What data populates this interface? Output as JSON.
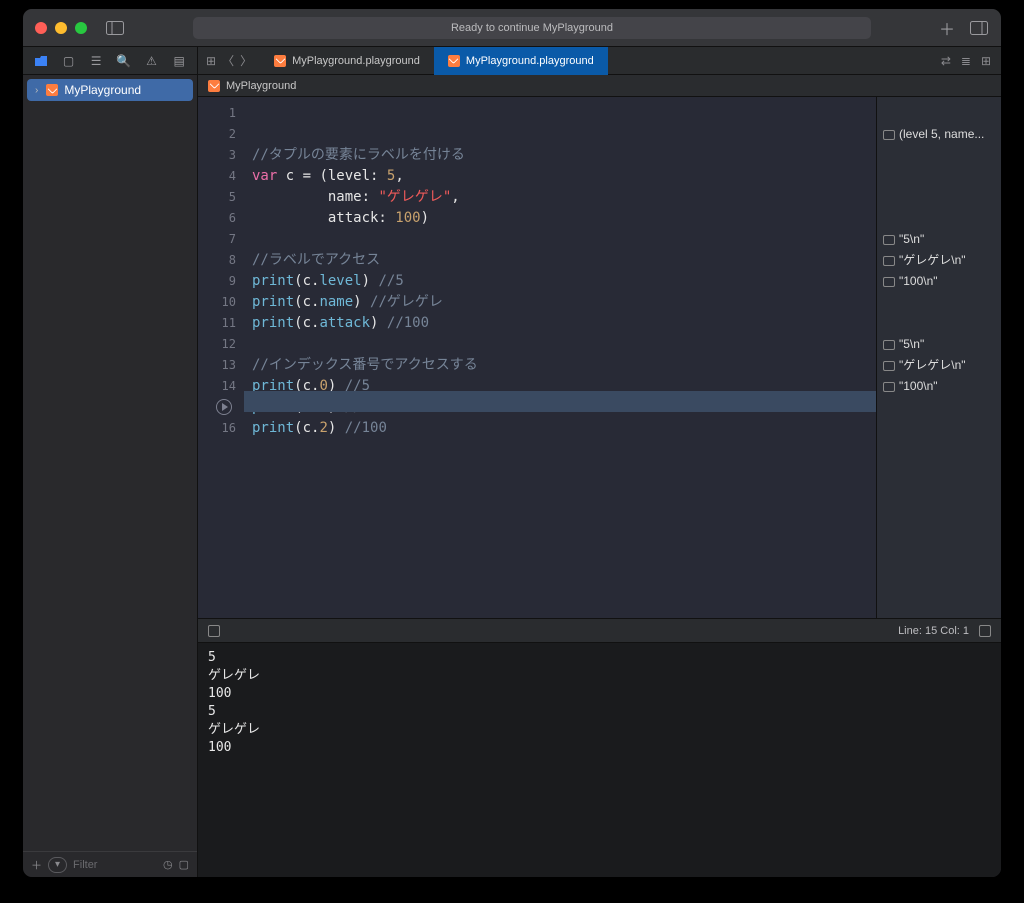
{
  "titlebar": {
    "status": "Ready to continue MyPlayground"
  },
  "tabs": {
    "tab1": "MyPlayground.playground",
    "tab2": "MyPlayground.playground"
  },
  "sidebar": {
    "project": "MyPlayground",
    "filter_placeholder": "Filter"
  },
  "breadcrumb": {
    "item1": "MyPlayground"
  },
  "code": {
    "l1_comment": "//タプルの要素にラベルを付ける",
    "l2_pre_kw": "var",
    "l2_mid": " c = (level: ",
    "l2_num": "5",
    "l2_suf": ",",
    "l3_pre": "         name: ",
    "l3_str": "\"ゲレゲレ\"",
    "l3_suf": ",",
    "l4_pre": "         attack: ",
    "l4_num": "100",
    "l4_suf": ")",
    "l6_comment": "//ラベルでアクセス",
    "l7_func": "print",
    "l7_arg_open": "(c.",
    "l7_prop": "level",
    "l7_arg_close": ") ",
    "l7_comment": "//5",
    "l8_func": "print",
    "l8_arg_open": "(c.",
    "l8_prop": "name",
    "l8_arg_close": ") ",
    "l8_comment": "//ゲレゲレ",
    "l9_func": "print",
    "l9_arg_open": "(c.",
    "l9_prop": "attack",
    "l9_arg_close": ") ",
    "l9_comment": "//100",
    "l11_comment": "//インデックス番号でアクセスする",
    "l12_func": "print",
    "l12_arg_open": "(c.",
    "l12_prop": "0",
    "l12_arg_close": ") ",
    "l12_comment": "//5",
    "l13_func": "print",
    "l13_arg_open": "(c.",
    "l13_prop": "1",
    "l13_arg_close": ") ",
    "l13_comment": "//ゲレゲレ",
    "l14_func": "print",
    "l14_arg_open": "(c.",
    "l14_prop": "2",
    "l14_arg_close": ") ",
    "l14_comment": "//100"
  },
  "line_numbers": [
    "1",
    "2",
    "3",
    "4",
    "5",
    "6",
    "7",
    "8",
    "9",
    "10",
    "11",
    "12",
    "13",
    "14",
    "",
    "16"
  ],
  "results": {
    "r2": "(level 5, name...",
    "r7": "\"5\\n\"",
    "r8": "\"ゲレゲレ\\n\"",
    "r9": "\"100\\n\"",
    "r12": "\"5\\n\"",
    "r13": "\"ゲレゲレ\\n\"",
    "r14": "\"100\\n\""
  },
  "console_bar": {
    "status": "Line: 15  Col: 1"
  },
  "console_output": "5\nゲレゲレ\n100\n5\nゲレゲレ\n100"
}
